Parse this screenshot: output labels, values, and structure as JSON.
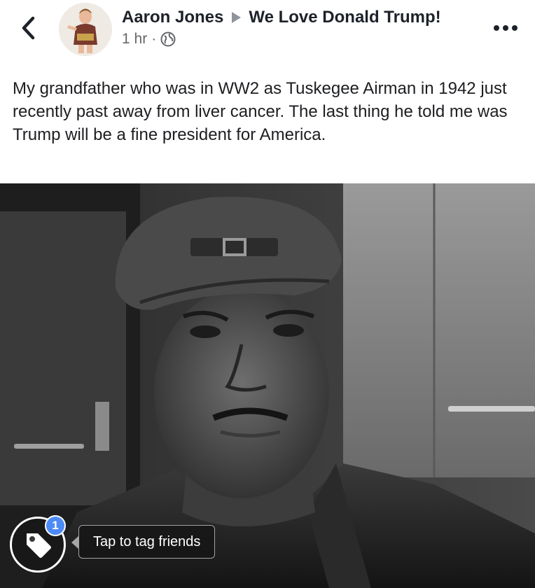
{
  "header": {
    "author": "Aaron Jones",
    "group": "We Love Donald Trump!",
    "time": "1 hr",
    "separator": "·",
    "privacy_icon": "globe-icon",
    "back_icon": "chevron-left-icon",
    "more_icon": "more-horizontal-icon"
  },
  "post": {
    "text": "My grandfather who was in WW2 as Tuskegee Airman in 1942 just recently past away from liver cancer. The last thing he told me was Trump will be a fine president for America."
  },
  "photo": {
    "tag_icon": "tag-icon",
    "tag_count": "1",
    "tag_prompt": "Tap to tag friends"
  },
  "colors": {
    "name_text": "#1d2129",
    "meta_text": "#65676b",
    "badge": "#4c8bf5",
    "background": "#ffffff"
  }
}
